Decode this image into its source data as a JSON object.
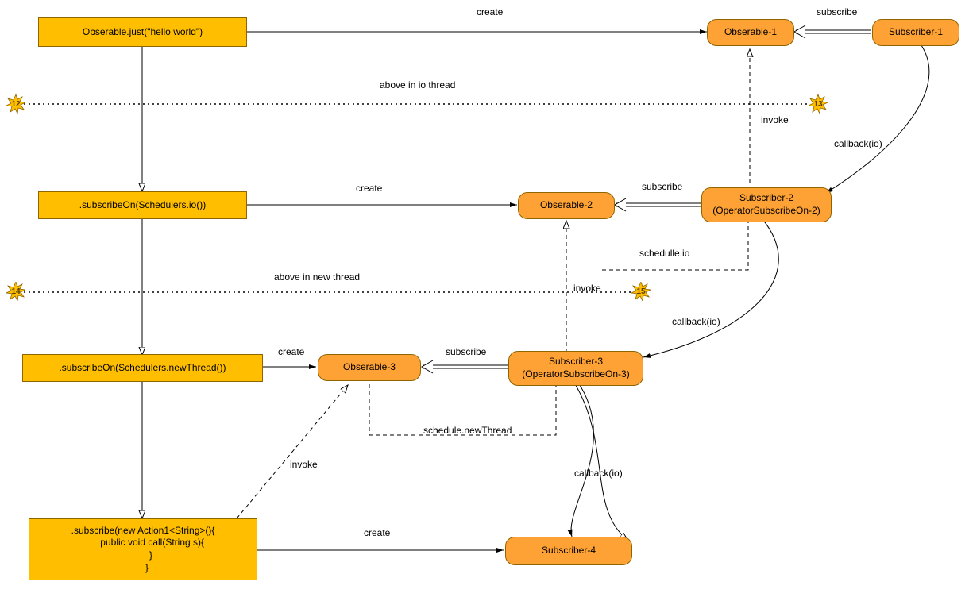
{
  "nodes": {
    "obs_just": "Obserable.just(\"hello world\")",
    "sub_on_io": ".subscribeOn(Schedulers.io())",
    "sub_on_new": ".subscribeOn(Schedulers.newThread())",
    "sub_action": ".subscribe(new Action1<String>(){\n       public void call(String s){\n      }\n   }",
    "obs1": "Obserable-1",
    "obs2": "Obserable-2",
    "obs3": "Obserable-3",
    "subscriber1": "Subscriber-1",
    "subscriber2": "Subscriber-2\n(OperatorSubscribeOn-2)",
    "subscriber3": "Subscriber-3\n(OperatorSubscribeOn-3)",
    "subscriber4": "Subscriber-4"
  },
  "edge_labels": {
    "create1": "create",
    "create2": "create",
    "create3": "create",
    "create4": "create",
    "subscribe1": "subscribe",
    "subscribe2": "subscribe",
    "subscribe3": "subscribe",
    "invoke1": "invoke",
    "invoke2": "invoke",
    "invoke3": "invoke",
    "callback_io1": "callback(io)",
    "callback_io2": "callback(io)",
    "callback_io3": "callback(io)",
    "schedule_io": "schedulle.io",
    "schedule_new": "schedule.newThread",
    "above_io": "above in io thread",
    "above_new": "above in new thread"
  },
  "stars": {
    "s12": "12",
    "s13": "13",
    "s14": "14",
    "s15": "15"
  }
}
